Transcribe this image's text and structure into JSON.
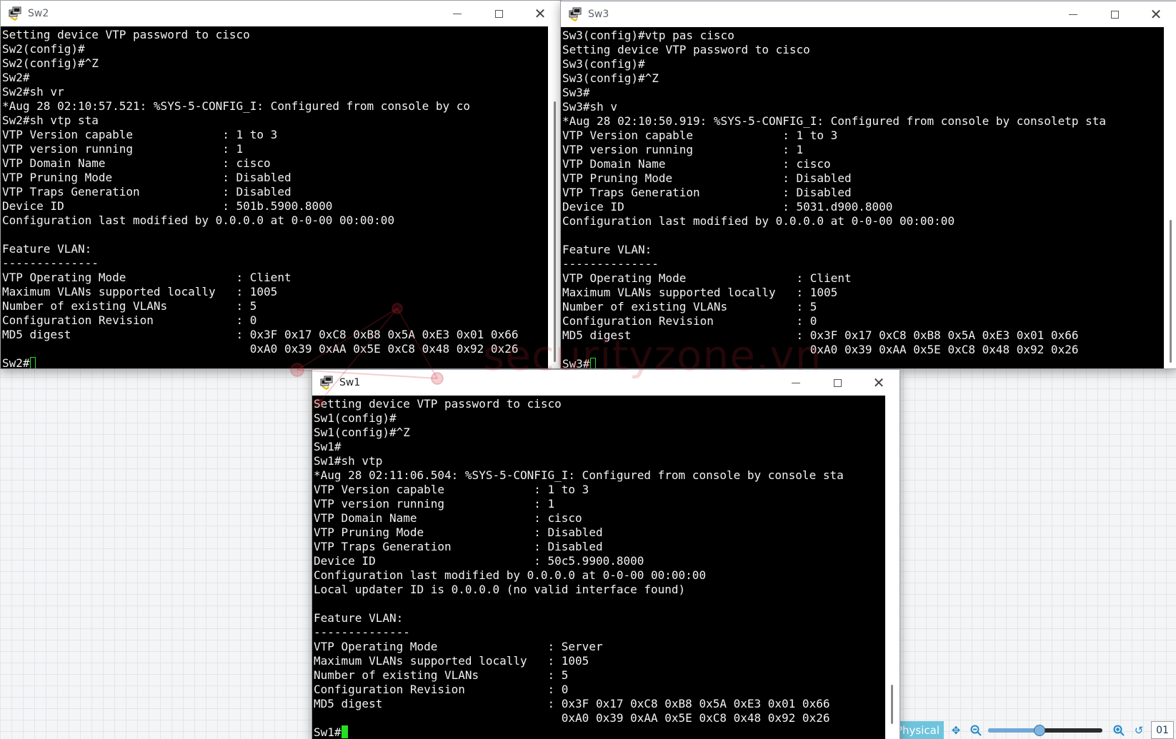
{
  "windows": {
    "sw2": {
      "title": "Sw2",
      "lines": [
        "Setting device VTP password to cisco",
        "Sw2(config)#",
        "Sw2(config)#^Z",
        "Sw2#",
        "Sw2#sh vr",
        "*Aug 28 02:10:57.521: %SYS-5-CONFIG_I: Configured from console by co",
        "Sw2#sh vtp sta",
        "VTP Version capable             : 1 to 3",
        "VTP version running             : 1",
        "VTP Domain Name                 : cisco",
        "VTP Pruning Mode                : Disabled",
        "VTP Traps Generation            : Disabled",
        "Device ID                       : 501b.5900.8000",
        "Configuration last modified by 0.0.0.0 at 0-0-00 00:00:00",
        "",
        "Feature VLAN:",
        "--------------",
        "VTP Operating Mode                : Client",
        "Maximum VLANs supported locally   : 1005",
        "Number of existing VLANs          : 5",
        "Configuration Revision            : 0",
        "MD5 digest                        : 0x3F 0x17 0xC8 0xB8 0x5A 0xE3 0x01 0x66",
        "                                    0xA0 0x39 0xAA 0x5E 0xC8 0x48 0x92 0x26"
      ],
      "prompt": "Sw2#"
    },
    "sw3": {
      "title": "Sw3",
      "lines": [
        "Sw3(config)#vtp pas cisco",
        "Setting device VTP password to cisco",
        "Sw3(config)#",
        "Sw3(config)#^Z",
        "Sw3#",
        "Sw3#sh v",
        "*Aug 28 02:10:50.919: %SYS-5-CONFIG_I: Configured from console by consoletp sta",
        "VTP Version capable             : 1 to 3",
        "VTP version running             : 1",
        "VTP Domain Name                 : cisco",
        "VTP Pruning Mode                : Disabled",
        "VTP Traps Generation            : Disabled",
        "Device ID                       : 5031.d900.8000",
        "Configuration last modified by 0.0.0.0 at 0-0-00 00:00:00",
        "",
        "Feature VLAN:",
        "--------------",
        "VTP Operating Mode                : Client",
        "Maximum VLANs supported locally   : 1005",
        "Number of existing VLANs          : 5",
        "Configuration Revision            : 0",
        "MD5 digest                        : 0x3F 0x17 0xC8 0xB8 0x5A 0xE3 0x01 0x66",
        "                                    0xA0 0x39 0xAA 0x5E 0xC8 0x48 0x92 0x26"
      ],
      "prompt": "Sw3#"
    },
    "sw1": {
      "title": "Sw1",
      "lines": [
        "Setting device VTP password to cisco",
        "Sw1(config)#",
        "Sw1(config)#^Z",
        "Sw1#",
        "Sw1#sh vtp",
        "*Aug 28 02:11:06.504: %SYS-5-CONFIG_I: Configured from console by console sta",
        "VTP Version capable             : 1 to 3",
        "VTP version running             : 1",
        "VTP Domain Name                 : cisco",
        "VTP Pruning Mode                : Disabled",
        "VTP Traps Generation            : Disabled",
        "Device ID                       : 50c5.9900.8000",
        "Configuration last modified by 0.0.0.0 at 0-0-00 00:00:00",
        "Local updater ID is 0.0.0.0 (no valid interface found)",
        "",
        "Feature VLAN:",
        "--------------",
        "VTP Operating Mode                : Server",
        "Maximum VLANs supported locally   : 1005",
        "Number of existing VLANs          : 5",
        "Configuration Revision            : 0",
        "MD5 digest                        : 0x3F 0x17 0xC8 0xB8 0x5A 0xE3 0x01 0x66",
        "                                    0xA0 0x39 0xAA 0x5E 0xC8 0x48 0x92 0x26"
      ],
      "prompt": "Sw1#"
    }
  },
  "watermark": {
    "text": "securityzone.vn"
  },
  "toolbar": {
    "physical_tab": "Physical",
    "page_value": "01",
    "zoom_level": 0.45
  },
  "colors": {
    "console_bg": "#000000",
    "console_fg": "#f2f2f2",
    "cursor": "#22e022",
    "physical_tab": "#6fc4dd"
  },
  "icons": {
    "app": "putty-terminal-icon",
    "minimize": "minimize-icon",
    "maximize": "maximize-icon",
    "close": "close-icon"
  }
}
